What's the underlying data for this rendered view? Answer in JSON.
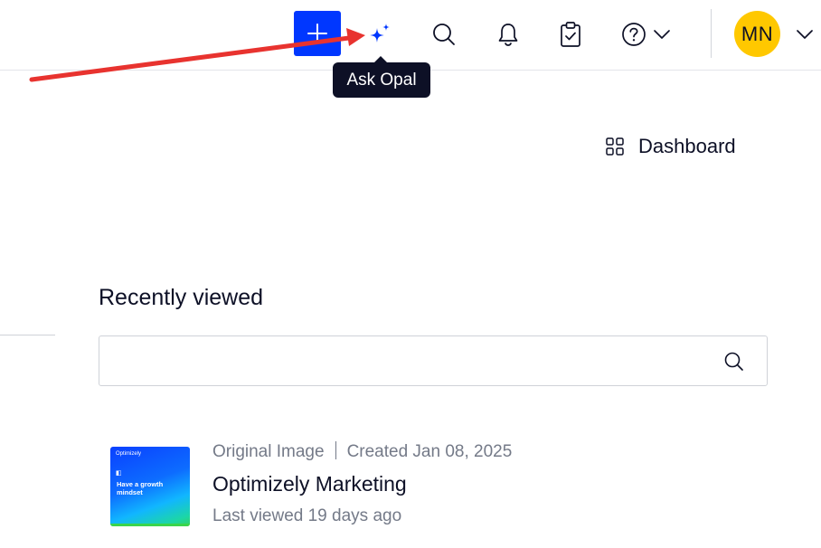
{
  "header": {
    "add_icon": "plus-icon",
    "opal_icon": "sparkle-icon",
    "search_icon": "search-icon",
    "notifications_icon": "bell-icon",
    "tasks_icon": "clipboard-check-icon",
    "help_icon": "help-circle-icon",
    "avatar_initials": "MN",
    "accent_color": "#0037ff",
    "avatar_color": "#ffc800"
  },
  "tooltip": {
    "text": "Ask Opal"
  },
  "annotation": {
    "arrow_color": "#e8332f"
  },
  "main": {
    "dashboard_label": "Dashboard",
    "dashboard_icon": "grid-icon",
    "recently_viewed_title": "Recently viewed",
    "search": {
      "value": "",
      "placeholder": ""
    },
    "items": [
      {
        "type": "Original Image",
        "created": "Created Jan 08, 2025",
        "title": "Optimizely Marketing",
        "last_viewed": "Last viewed 19 days ago",
        "thumbnail": {
          "brand": "Optimizely",
          "text": "Have a growth mindset"
        }
      }
    ]
  }
}
